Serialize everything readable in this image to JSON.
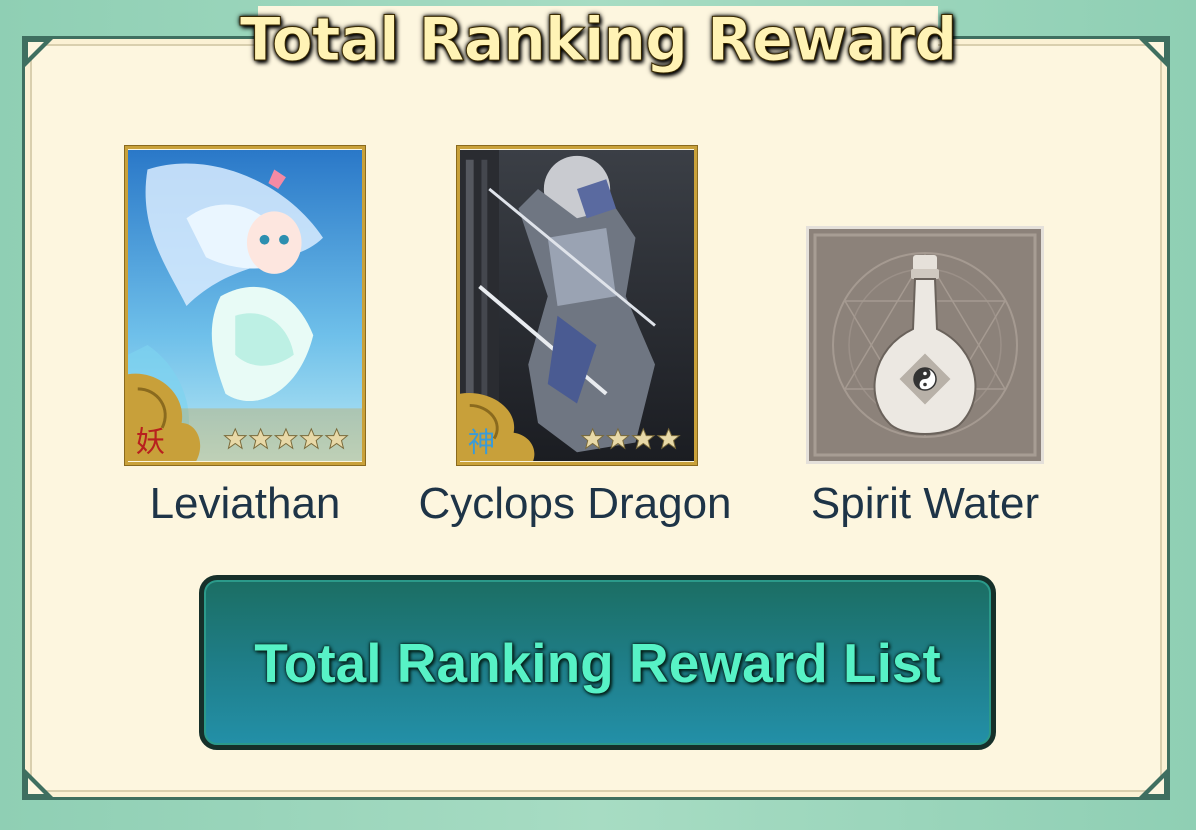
{
  "dialog": {
    "title": "Total Ranking Reward"
  },
  "rewards": [
    {
      "name": "Leviathan",
      "kind": "character-card",
      "attribute_glyph": "妖",
      "stars": 5,
      "icon": "leviathan-card-art"
    },
    {
      "name": "Cyclops Dragon",
      "kind": "character-card",
      "attribute_glyph": "神",
      "stars": 4,
      "icon": "cyclops-dragon-card-art"
    },
    {
      "name": "Spirit Water",
      "kind": "item",
      "icon": "spirit-water-bottle-icon"
    }
  ],
  "button": {
    "label": "Total Ranking Reward List"
  },
  "colors": {
    "background": "#9fd7bd",
    "panel": "#fdf6df",
    "title_text": "#fff3b5",
    "label_text": "#1e3447",
    "button_fill": "#1f7f8b",
    "button_text": "#57f2c6",
    "card_frame": "#c9a13a"
  }
}
